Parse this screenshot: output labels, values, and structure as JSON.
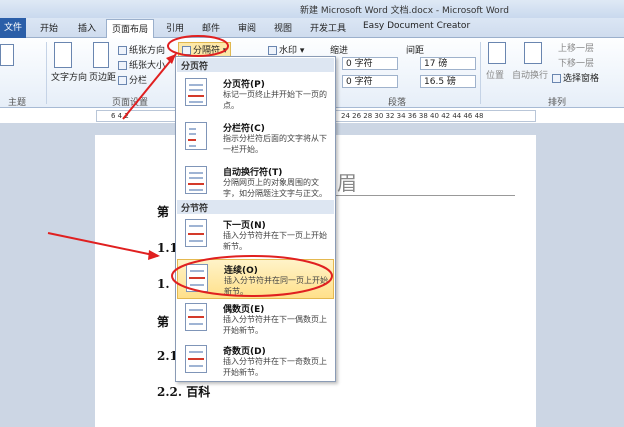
{
  "window": {
    "title": "新建 Microsoft Word 文档.docx - Microsoft Word"
  },
  "tabs": [
    "文件",
    "开始",
    "插入",
    "页面布局",
    "引用",
    "邮件",
    "审阅",
    "视图",
    "开发工具",
    "Easy Document Creator"
  ],
  "ribbon": {
    "page_setup": {
      "text_direction": "文字方向",
      "margins": "页边距",
      "orientation": "纸张方向",
      "size": "纸张大小",
      "columns": "分栏",
      "breaks": "分隔符",
      "label": "页面设置"
    },
    "theme_label": "主题",
    "watermark": "水印",
    "indent": {
      "label": "缩进",
      "value1": "0 字符",
      "value2": "0 字符"
    },
    "spacing": {
      "label": "间距",
      "before": "17 磅",
      "after": "16.5 磅"
    },
    "paragraph_label": "段落",
    "arrange": {
      "label": "排列",
      "position": "位置",
      "wrap": "自动换行",
      "bring_forward": "上移一层",
      "send_backward": "下移一层",
      "selection_pane": "选择窗格"
    }
  },
  "ruler": {
    "left_marks": "6  4  2",
    "right_marks": "24  26  28  30  32  34  36  38  40  42  44  46  48"
  },
  "document": {
    "header": "眉",
    "lines": [
      "第",
      "1.1",
      "1.",
      "第",
      "2.1",
      "2.2. 百科"
    ]
  },
  "dropdown": {
    "section_page": "分页符",
    "section_section": "分节符",
    "items": [
      {
        "title": "分页符(P)",
        "desc": "标记一页终止并开始下一页的点。"
      },
      {
        "title": "分栏符(C)",
        "desc": "指示分栏符后面的文字将从下一栏开始。"
      },
      {
        "title": "自动换行符(T)",
        "desc": "分隔网页上的对象周围的文字，如分隔题注文字与正文。"
      },
      {
        "title": "下一页(N)",
        "desc": "插入分节符并在下一页上开始新节。"
      },
      {
        "title": "连续(O)",
        "desc": "插入分节符并在同一页上开始新节。"
      },
      {
        "title": "偶数页(E)",
        "desc": "插入分节符并在下一偶数页上开始新节。"
      },
      {
        "title": "奇数页(D)",
        "desc": "插入分节符并在下一奇数页上开始新节。"
      }
    ]
  },
  "colors": {
    "annotation_red": "#e02020",
    "highlight": "#ffe08a",
    "tab_file": "#2a5ea8"
  }
}
